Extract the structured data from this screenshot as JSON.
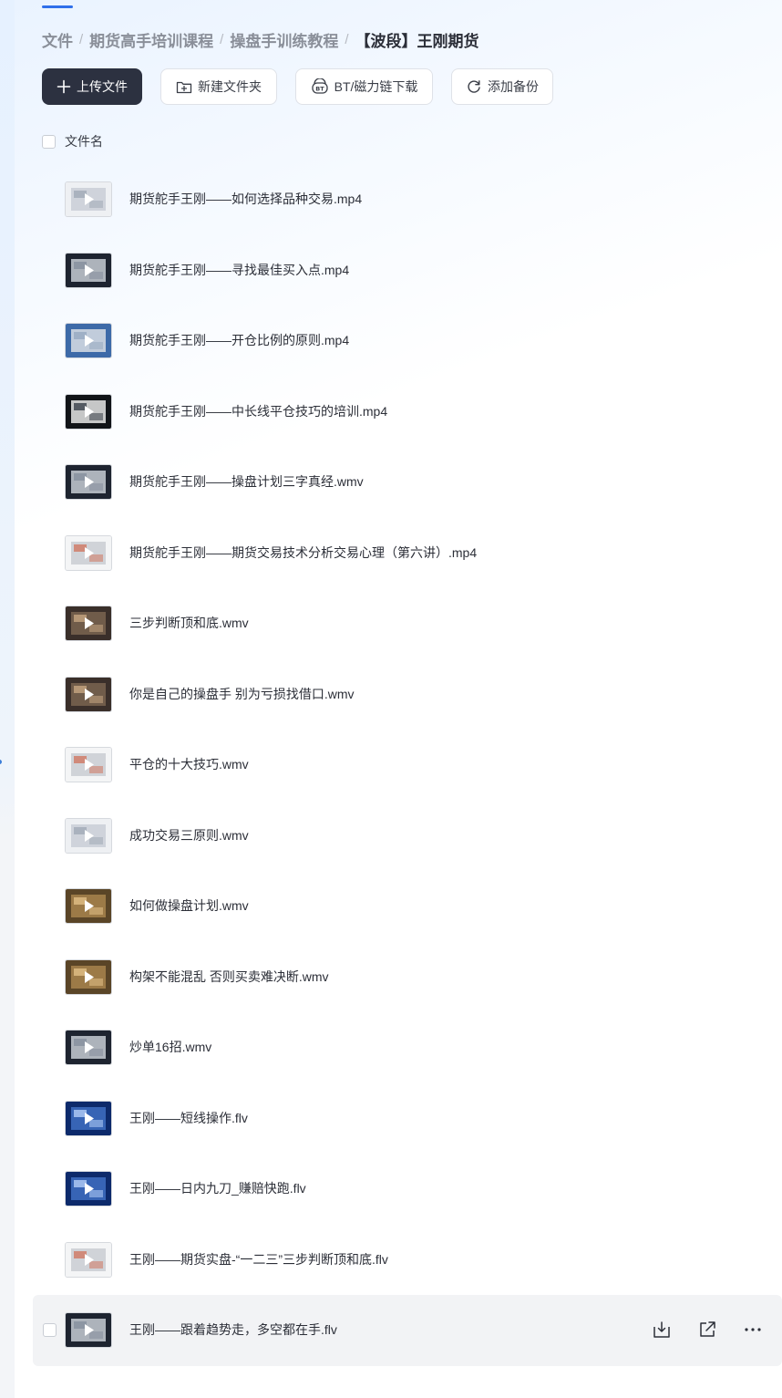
{
  "breadcrumb": {
    "items": [
      "文件",
      "期货高手培训课程",
      "操盘手训练教程"
    ],
    "current": "【波段】王刚期货",
    "separator": "/"
  },
  "toolbar": {
    "upload_label": "上传文件",
    "new_folder_label": "新建文件夹",
    "bt_label": "BT/磁力链下载",
    "backup_label": "添加备份"
  },
  "list": {
    "header_label": "文件名"
  },
  "files": [
    {
      "name": "期货舵手王刚——如何选择品种交易.mp4",
      "thumb": "doc"
    },
    {
      "name": "期货舵手王刚——寻找最佳买入点.mp4",
      "thumb": "screen"
    },
    {
      "name": "期货舵手王刚——开仓比例的原则.mp4",
      "thumb": "blue"
    },
    {
      "name": "期货舵手王刚——中长线平仓技巧的培训.mp4",
      "thumb": "dark"
    },
    {
      "name": "期货舵手王刚——操盘计划三字真经.wmv",
      "thumb": "screen"
    },
    {
      "name": "期货舵手王刚——期货交易技术分析交易心理（第六讲）.mp4",
      "thumb": "chart"
    },
    {
      "name": "三步判断顶和底.wmv",
      "thumb": "room"
    },
    {
      "name": "你是自己的操盘手 别为亏损找借口.wmv",
      "thumb": "room"
    },
    {
      "name": "平仓的十大技巧.wmv",
      "thumb": "chart"
    },
    {
      "name": "成功交易三原则.wmv",
      "thumb": "doc"
    },
    {
      "name": "如何做操盘计划.wmv",
      "thumb": "warm"
    },
    {
      "name": "构架不能混乱 否则买卖难决断.wmv",
      "thumb": "warm"
    },
    {
      "name": "炒单16招.wmv",
      "thumb": "screen"
    },
    {
      "name": "王刚——短线操作.flv",
      "thumb": "navy"
    },
    {
      "name": "王刚——日内九刀_赚赔快跑.flv",
      "thumb": "navy"
    },
    {
      "name": "王刚——期货实盘-“一二三”三步判断顶和底.flv",
      "thumb": "chart"
    },
    {
      "name": "王刚——跟着趋势走，多空都在手.flv",
      "thumb": "screen"
    }
  ],
  "hovered_index": 16,
  "colors": {
    "accent": "#2f6fea",
    "primary_button": "#2c3140",
    "hover_row": "#f2f3f5"
  }
}
